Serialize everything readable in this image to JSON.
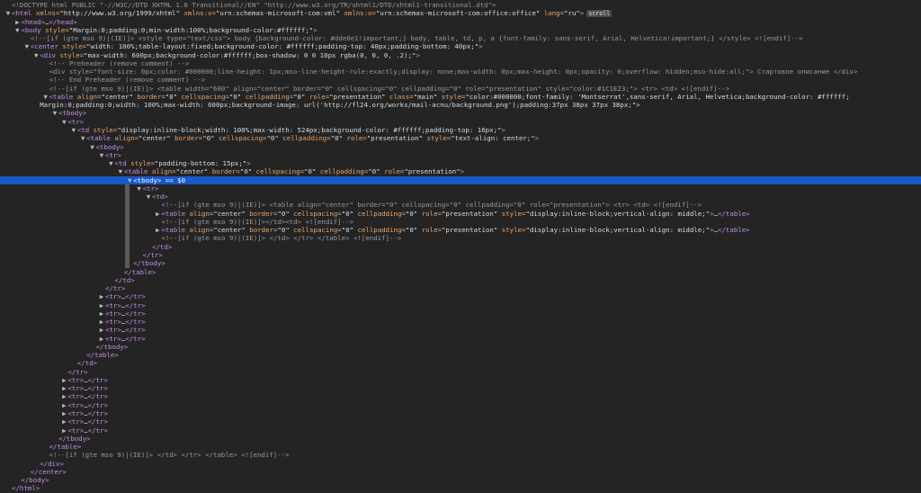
{
  "devtools": {
    "lines": [
      {
        "depth": 0,
        "tw": "",
        "text": "<!DOCTYPE html PUBLIC \"-//W3C//DTD XHTML 1.0 Transitional//EN\" \"http://www.w3.org/TR/xhtml1/DTD/xhtml1-transitional.dtd\">",
        "kind": "cm"
      },
      {
        "depth": 0,
        "tw": "▼",
        "text": "<html xmlns=\"http://www.w3.org/1999/xhtml\" xmlns:v=\"urn:schemas-microsoft-com:vml\" xmlns:o=\"urn:schemas-microsoft-com:office:office\" lang=\"ru\">",
        "kind": "tag",
        "badge": "scroll"
      },
      {
        "depth": 1,
        "tw": "▶",
        "text": "<head>…</head>",
        "kind": "tag"
      },
      {
        "depth": 1,
        "tw": "▼",
        "text": "<body style=\"Margin:0;padding:0;min-width:100%;background-color:#ffffff;\">",
        "kind": "tag"
      },
      {
        "depth": 2,
        "tw": "",
        "text": "<!--[if (gte mso 9)|(IE)]> <style type=\"text/css\"> body {background-color: #dde0e1!important;} body, table, td, p, a {font-family: sans-serif, Arial, Helvetica!important;} </style> <![endif]-->",
        "kind": "cm"
      },
      {
        "depth": 2,
        "tw": "▼",
        "text": "<center style=\"width: 100%;table-layout:fixed;background-color: #ffffff;padding-top: 40px;padding-bottom: 40px;\">",
        "kind": "tag"
      },
      {
        "depth": 3,
        "tw": "▼",
        "text": "<div style=\"max-width: 600px;background-color:#ffffff;box-shadow: 0 0 10px rgba(0, 0, 0, .2);\">",
        "kind": "tag"
      },
      {
        "depth": 4,
        "tw": "",
        "text": "<!-- Preheader (remove comment) -->",
        "kind": "cm"
      },
      {
        "depth": 4,
        "tw": "",
        "text": "<div style=\"font-size: 0px;color: #000000;line-height: 1px;mso-line-height-rule:exactly;display: none;max-width: 0px;max-height: 0px;opacity: 0;overflow: hidden;mso-hide:all;\"> Стартовое описание </div>",
        "kind": "cm"
      },
      {
        "depth": 4,
        "tw": "",
        "text": "<!-- End Preheader (remove comment) -->",
        "kind": "cm"
      },
      {
        "depth": 4,
        "tw": "",
        "text": "<!--[if (gte mso 9)|(IE)]> <table width=\"600\" align=\"center\" border=\"0\" cellspacing=\"0\" cellpadding=\"0\" role=\"presentation\" style=\"color:#1C1E23;\"> <tr> <td> <![endif]-->",
        "kind": "cm"
      },
      {
        "depth": 4,
        "tw": "▼",
        "text": "<table align=\"center\" border=\"0\" cellspacing=\"0\" cellpadding=\"0\" role=\"presentation\" class=\"main\" style=\"color:#000000;font-family: 'Montserrat',sans-serif, Arial, Helvetica;background-color: #ffffff;",
        "kind": "tag"
      },
      {
        "depth": 3,
        "tw": "",
        "text": "Margin:0;padding:0;width: 100%;max-width: 600px;background-image: url('http://fl24.org/works/mail-acnu/background.png');padding:37px 38px 37px 38px;\">",
        "kind": "av"
      },
      {
        "depth": 5,
        "tw": "▼",
        "text": "<tbody>",
        "kind": "tag"
      },
      {
        "depth": 6,
        "tw": "▼",
        "text": "<tr>",
        "kind": "tag"
      },
      {
        "depth": 7,
        "tw": "▼",
        "text": "<td style=\"display:inline-block;width: 100%;max-width: 524px;background-color: #ffffff;padding-top: 16px;\">",
        "kind": "tag"
      },
      {
        "depth": 8,
        "tw": "▼",
        "text": "<table align=\"center\" border=\"0\" cellspacing=\"0\" cellpadding=\"0\" role=\"presentation\" style=\"text-align: center;\">",
        "kind": "tag"
      },
      {
        "depth": 9,
        "tw": "▼",
        "text": "<tbody>",
        "kind": "tag"
      },
      {
        "depth": 10,
        "tw": "▼",
        "text": "<tr>",
        "kind": "tag"
      },
      {
        "depth": 11,
        "tw": "▼",
        "text": "<td style=\"padding-bottom: 15px;\">",
        "kind": "tag"
      },
      {
        "depth": 12,
        "tw": "▼",
        "text": "<table align=\"center\" border=\"0\" cellspacing=\"0\" cellpadding=\"0\" role=\"presentation\">",
        "kind": "tag"
      },
      {
        "depth": 13,
        "tw": "▼",
        "text": "<tbody> == $0",
        "kind": "tag",
        "selected": true
      },
      {
        "depth": 14,
        "tw": "▼",
        "text": "<tr>",
        "kind": "tag"
      },
      {
        "depth": 15,
        "tw": "▼",
        "text": "<td>",
        "kind": "tag"
      },
      {
        "depth": 16,
        "tw": "",
        "text": "<!--[if (gte mso 9)|(IE)]> <table align=\"center\" border=\"0\" cellspacing=\"0\" cellpadding=\"0\" role=\"presentation\"> <tr> <td> <![endif]-->",
        "kind": "cm"
      },
      {
        "depth": 16,
        "tw": "▶",
        "text": "<table align=\"center\" border=\"0\" cellspacing=\"0\" cellpadding=\"0\" role=\"presentation\" style=\"display:inline-block;vertical-align: middle;\">…</table>",
        "kind": "tag"
      },
      {
        "depth": 16,
        "tw": "",
        "text": "<!--[if (gte mso 9)|(IE)]></td><td> <![endif]-->",
        "kind": "cm"
      },
      {
        "depth": 16,
        "tw": "▶",
        "text": "<table align=\"center\" border=\"0\" cellspacing=\"0\" cellpadding=\"0\" role=\"presentation\" style=\"display:inline-block;vertical-align: middle;\">…</table>",
        "kind": "tag"
      },
      {
        "depth": 16,
        "tw": "",
        "text": "<!--[if (gte mso 9)|(IE)]> </td> </tr> </table> <![endif]-->",
        "kind": "cm"
      },
      {
        "depth": 15,
        "tw": "",
        "text": "</td>",
        "kind": "tag"
      },
      {
        "depth": 14,
        "tw": "",
        "text": "</tr>",
        "kind": "tag"
      },
      {
        "depth": 13,
        "tw": "",
        "text": "</tbody>",
        "kind": "tag"
      },
      {
        "depth": 12,
        "tw": "",
        "text": "</table>",
        "kind": "tag"
      },
      {
        "depth": 11,
        "tw": "",
        "text": "</td>",
        "kind": "tag"
      },
      {
        "depth": 10,
        "tw": "",
        "text": "</tr>",
        "kind": "tag"
      },
      {
        "depth": 10,
        "tw": "▶",
        "text": "<tr>…</tr>",
        "kind": "tag"
      },
      {
        "depth": 10,
        "tw": "▶",
        "text": "<tr>…</tr>",
        "kind": "tag"
      },
      {
        "depth": 10,
        "tw": "▶",
        "text": "<tr>…</tr>",
        "kind": "tag"
      },
      {
        "depth": 10,
        "tw": "▶",
        "text": "<tr>…</tr>",
        "kind": "tag"
      },
      {
        "depth": 10,
        "tw": "▶",
        "text": "<tr>…</tr>",
        "kind": "tag"
      },
      {
        "depth": 10,
        "tw": "▶",
        "text": "<tr>…</tr>",
        "kind": "tag"
      },
      {
        "depth": 9,
        "tw": "",
        "text": "</tbody>",
        "kind": "tag"
      },
      {
        "depth": 8,
        "tw": "",
        "text": "</table>",
        "kind": "tag"
      },
      {
        "depth": 7,
        "tw": "",
        "text": "</td>",
        "kind": "tag"
      },
      {
        "depth": 6,
        "tw": "",
        "text": "</tr>",
        "kind": "tag"
      },
      {
        "depth": 6,
        "tw": "▶",
        "text": "<tr>…</tr>",
        "kind": "tag"
      },
      {
        "depth": 6,
        "tw": "▶",
        "text": "<tr>…</tr>",
        "kind": "tag"
      },
      {
        "depth": 6,
        "tw": "▶",
        "text": "<tr>…</tr>",
        "kind": "tag"
      },
      {
        "depth": 6,
        "tw": "▶",
        "text": "<tr>…</tr>",
        "kind": "tag"
      },
      {
        "depth": 6,
        "tw": "▶",
        "text": "<tr>…</tr>",
        "kind": "tag"
      },
      {
        "depth": 6,
        "tw": "▶",
        "text": "<tr>…</tr>",
        "kind": "tag"
      },
      {
        "depth": 6,
        "tw": "▶",
        "text": "<tr>…</tr>",
        "kind": "tag"
      },
      {
        "depth": 5,
        "tw": "",
        "text": "</tbody>",
        "kind": "tag"
      },
      {
        "depth": 4,
        "tw": "",
        "text": "</table>",
        "kind": "tag"
      },
      {
        "depth": 4,
        "tw": "",
        "text": "<!--[if (gte mso 9)|(IE)]> </td> </tr> </table> <![endif]-->",
        "kind": "cm"
      },
      {
        "depth": 3,
        "tw": "",
        "text": "</div>",
        "kind": "tag"
      },
      {
        "depth": 2,
        "tw": "",
        "text": "</center>",
        "kind": "tag"
      },
      {
        "depth": 1,
        "tw": "",
        "text": "</body>",
        "kind": "tag"
      },
      {
        "depth": 0,
        "tw": "",
        "text": "</html>",
        "kind": "tag"
      }
    ]
  }
}
